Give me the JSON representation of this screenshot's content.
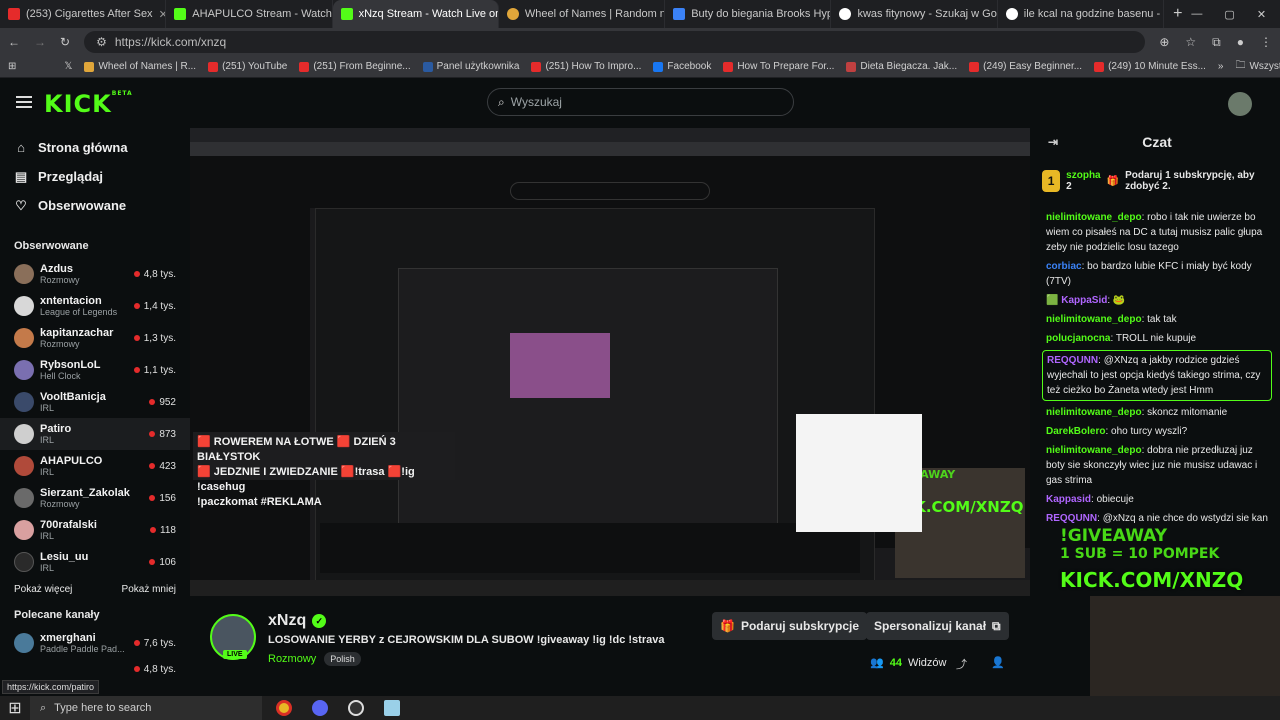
{
  "browser": {
    "tabs": [
      {
        "label": "(253) Cigarettes After Sex",
        "color": "#e52b2b"
      },
      {
        "label": "AHAPULCO Stream - Watch Liv",
        "color": "#53fc18"
      },
      {
        "label": "xNzq Stream - Watch Live on K",
        "color": "#53fc18"
      },
      {
        "label": "Wheel of Names | Random nam",
        "color": "#e0a63a"
      },
      {
        "label": "Buty do biegania Brooks Hyper",
        "color": "#3b82f6"
      },
      {
        "label": "kwas fitynowy - Szukaj w Goog",
        "color": "#ffffff"
      },
      {
        "label": "ile kcal na godzine basenu - Sz",
        "color": "#ffffff"
      }
    ],
    "url": "https://kick.com/xnzq",
    "bookmarks": [
      "Wheel of Names | R...",
      "(251) YouTube",
      "(251) From Beginne...",
      "Panel użytkownika",
      "(251) How To Impro...",
      "Facebook",
      "How To Prepare For...",
      "Dieta Biegacza. Jak...",
      "(249) Easy Beginner...",
      "(249) 10 Minute Ess..."
    ],
    "all_bookmarks": "Wszystkie zakładki",
    "status_url": "https://kick.com/patiro"
  },
  "header": {
    "logo": "KICK",
    "logo_beta": "BETA",
    "search_placeholder": "Wyszukaj"
  },
  "sidebar": {
    "nav": [
      {
        "label": "Strona główna",
        "icon": "home-icon"
      },
      {
        "label": "Przeglądaj",
        "icon": "browse-icon"
      },
      {
        "label": "Obserwowane",
        "icon": "heart-icon"
      }
    ],
    "followed_heading": "Obserwowane",
    "followed": [
      {
        "name": "Azdus",
        "category": "Rozmowy",
        "viewers": "4,8 tys.",
        "color": "#8a6f5a"
      },
      {
        "name": "xntentacion",
        "category": "League of Legends",
        "viewers": "1,4 tys.",
        "color": "#d8d8d8"
      },
      {
        "name": "kapitanzachar",
        "category": "Rozmowy",
        "viewers": "1,3 tys.",
        "color": "#c47a4a"
      },
      {
        "name": "RybsonLoL",
        "category": "Hell Clock",
        "viewers": "1,1 tys.",
        "color": "#7a6fb0"
      },
      {
        "name": "VooltBanicja",
        "category": "IRL",
        "viewers": "952",
        "color": "#3a4a6a"
      },
      {
        "name": "Patiro",
        "category": "IRL",
        "viewers": "873",
        "color": "#cfcfcf"
      },
      {
        "name": "AHAPULCO",
        "category": "IRL",
        "viewers": "423",
        "color": "#b04a3a"
      },
      {
        "name": "Sierzant_Zakolak",
        "category": "Rozmowy",
        "viewers": "156",
        "color": "#6a6a6a"
      },
      {
        "name": "700rafalski",
        "category": "IRL",
        "viewers": "118",
        "color": "#d9a0a0"
      },
      {
        "name": "Lesiu_uu",
        "category": "IRL",
        "viewers": "106",
        "color": "#2a2a2a"
      }
    ],
    "show_more": "Pokaż więcej",
    "show_less": "Pokaż mniej",
    "recommended_heading": "Polecane kanały",
    "recommended": [
      {
        "name": "xmerghani",
        "category": "Paddle Paddle Pad...",
        "viewers": "7,6 tys.",
        "color": "#4a7a9a"
      }
    ],
    "recommended_extra_viewers": "4,8 tys."
  },
  "player": {
    "promo_lines": [
      "🟥 ROWEREM NA ŁOTWE 🟥 DZIEŃ 3 BIAŁYSTOK",
      "🟥 JEDZNIE I ZWIEDZANIE 🟥!trasa 🟥!ig !casehug",
      "!paczkomat #REKLAMA"
    ],
    "overlay_giveaway": "!GIVEAWAY",
    "overlay_sub": "1 SUB = 10 POMPEK",
    "overlay_url": "KICK.COM/XNZQ"
  },
  "stream": {
    "name": "xNzq",
    "live": "LIVE",
    "title": "LOSOWANIE YERBY z CEJROWSKIM DLA SUBOW !giveaway !ig !dc !strava",
    "category": "Rozmowy",
    "tag": "Polish",
    "gift_button": "Podaruj subskrypcje",
    "sponsor_button": "Spersonalizuj kanał",
    "viewers_count": "44",
    "viewers_label": "Widzów"
  },
  "chat": {
    "title": "Czat",
    "pinned_user": "szopha",
    "pinned_count": "2",
    "pinned_text": "Podaruj 1 subskrypcję, aby zdobyć 2.",
    "messages": [
      {
        "user": "nielimitowane_depo",
        "cls": "u-green",
        "text": "robo i tak nie uwierze bo wiem co pisałeś na DC a tutaj musisz palic głupa zeby nie podzielic losu tazego"
      },
      {
        "user": "corbiac",
        "cls": "u-blue",
        "text": "bo bardzo lubie KFC i miały być kody (7TV)"
      },
      {
        "user": "KappaSid",
        "cls": "u-purple",
        "text": ""
      },
      {
        "user": "nielimitowane_depo",
        "cls": "u-green",
        "text": "tak tak"
      },
      {
        "user": "polucjanocna",
        "cls": "u-green",
        "text": "TROLL nie kupuje"
      },
      {
        "user": "REQQUNN",
        "cls": "u-purple",
        "text": "@XNzq a jakby rodzice gdzieś wyjechali to jest opcja kiedyś takiego strima, czy też cieżko bo Żaneta wtedy jest Hmm"
      },
      {
        "user": "nielimitowane_depo",
        "cls": "u-green",
        "text": "skoncz mitomanie"
      },
      {
        "user": "DarekBolero",
        "cls": "u-green",
        "text": "oho turcy wyszli?"
      },
      {
        "user": "nielimitowane_depo",
        "cls": "u-green",
        "text": "dobra nie przedłuzaj juz boty sie skonczyły wiec juz nie musisz udawac i gas strima"
      },
      {
        "user": "Kappasid",
        "cls": "u-purple",
        "text": "obiecuje"
      },
      {
        "user": "REQQUNN",
        "cls": "u-purple",
        "text": "@xNzq a nie chce do wstydzi sie kan"
      }
    ]
  },
  "taskbar": {
    "search_placeholder": "Type here to search"
  }
}
